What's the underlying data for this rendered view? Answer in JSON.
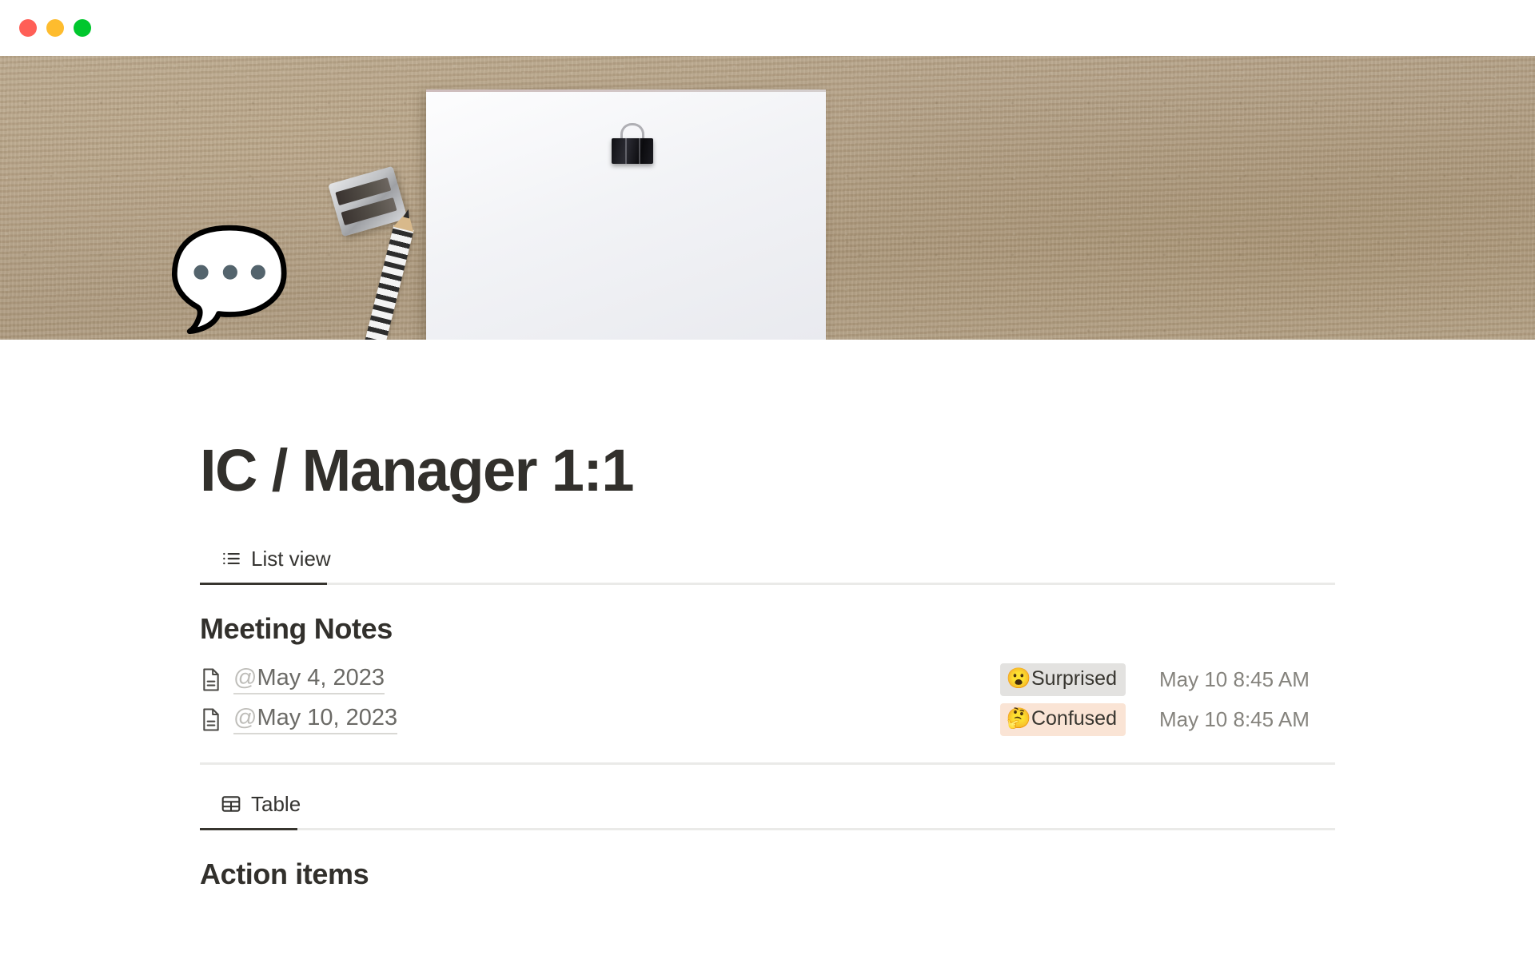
{
  "window": {
    "controls": [
      {
        "name": "close",
        "color": "#FF5F57"
      },
      {
        "name": "minimize",
        "color": "#FEBC2E"
      },
      {
        "name": "maximize",
        "color": "#00C72D"
      }
    ]
  },
  "cover": {
    "description": "kraft-paper desk flat-lay with white sheet, binder clip, sharpener and pencil"
  },
  "page": {
    "icon": "💬",
    "icon_name": "speech-balloon-emoji",
    "title": "IC / Manager 1:1"
  },
  "tabs": [
    {
      "label": "List view",
      "icon": "list-icon",
      "active": true
    },
    {
      "label": "Table",
      "icon": "table-grid-icon",
      "active": true
    }
  ],
  "list_view": {
    "heading": "Meeting Notes",
    "rows": [
      {
        "icon": "document-icon",
        "at": "@",
        "link": "May 4, 2023",
        "badge": {
          "emoji": "😮",
          "label": "Surprised",
          "bg": "#E3E2E0"
        },
        "time": "May 10 8:45 AM"
      },
      {
        "icon": "document-icon",
        "at": "@",
        "link": "May 10, 2023",
        "badge": {
          "emoji": "🤔",
          "label": "Confused",
          "bg": "#FAE4D5"
        },
        "time": "May 10 8:45 AM"
      }
    ]
  },
  "table_view": {
    "heading": "Action items"
  },
  "colors": {
    "text_primary": "#32302C",
    "text_muted": "#6B6A66",
    "text_time": "#85837D",
    "divider": "#EAEAE8",
    "tab_active": "#37352F"
  }
}
